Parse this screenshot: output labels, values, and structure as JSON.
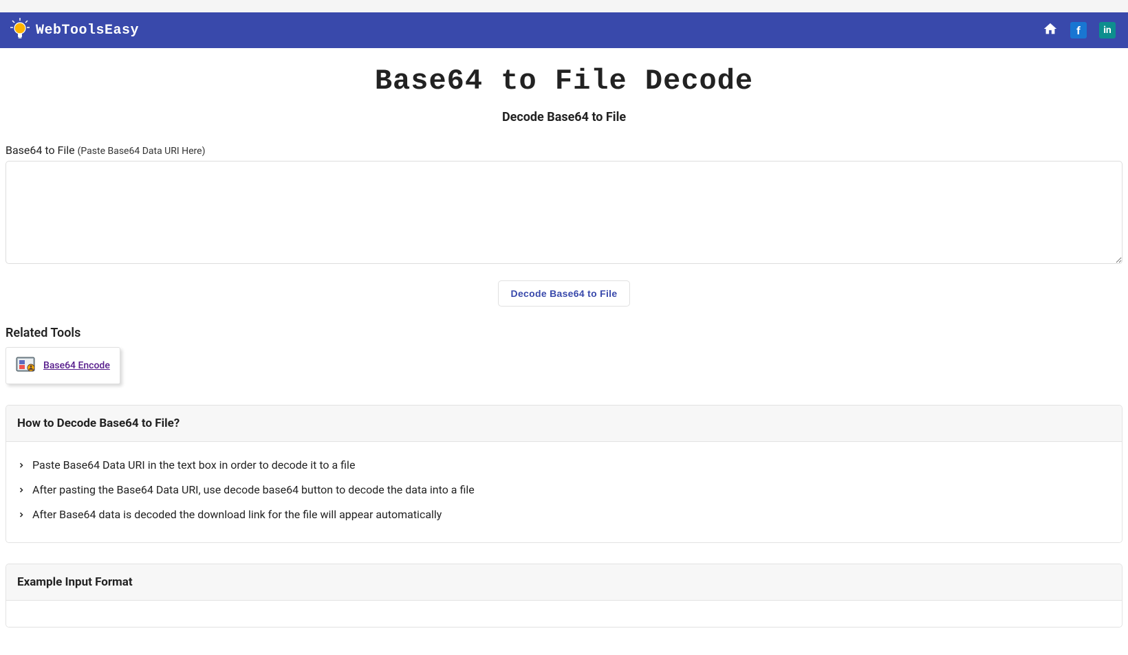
{
  "brand": {
    "name": "WebToolsEasy"
  },
  "nav": {
    "home_label": "Home",
    "facebook_label": "f",
    "linkedin_label": "in"
  },
  "page": {
    "title": "Base64 to File Decode",
    "subtitle": "Decode Base64 to File"
  },
  "input": {
    "label": "Base64 to File",
    "hint": "(Paste Base64 Data URI Here)",
    "value": ""
  },
  "actions": {
    "decode_label": "Decode Base64 to File"
  },
  "related": {
    "heading": "Related Tools",
    "items": [
      {
        "label": "Base64 Encode"
      }
    ]
  },
  "howto": {
    "heading": "How to Decode Base64 to File?",
    "steps": [
      "Paste Base64 Data URI in the text box in order to decode it to a file",
      "After pasting the Base64 Data URI, use decode base64 button to decode the data into a file",
      "After Base64 data is decoded the download link for the file will appear automatically"
    ]
  },
  "example": {
    "heading": "Example Input Format"
  }
}
